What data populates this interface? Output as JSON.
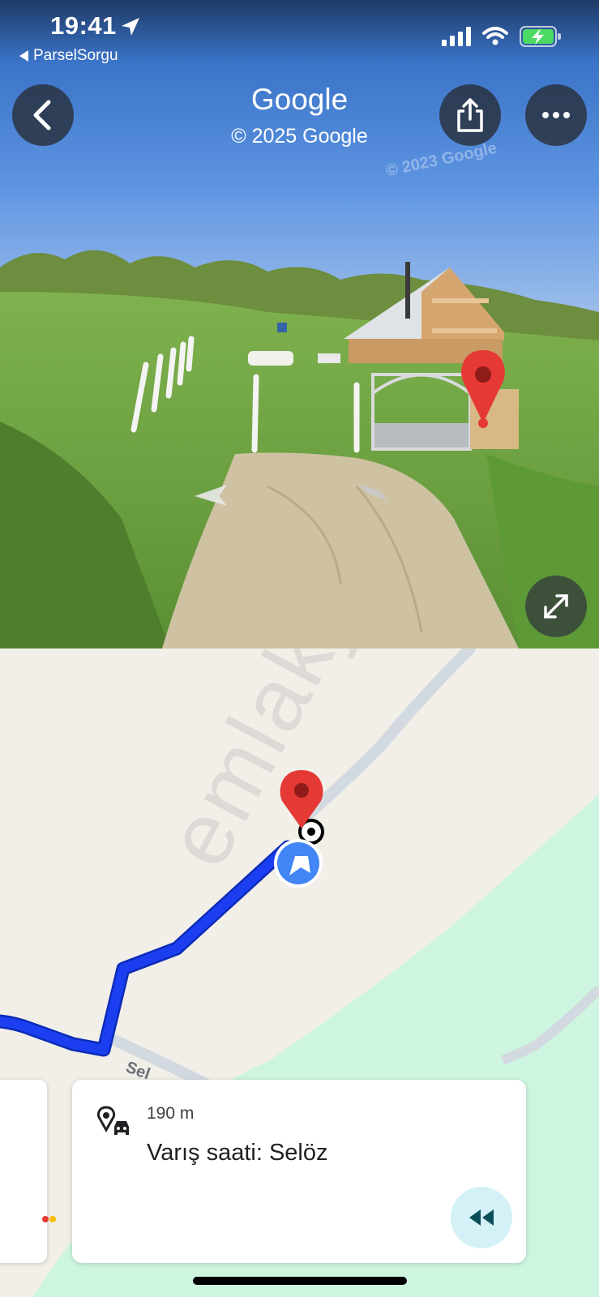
{
  "status_bar": {
    "time": "19:41",
    "back_app": "ParselSorgu",
    "battery_color": "#4cd964"
  },
  "street_view": {
    "title": "Google",
    "copyright": "© 2025 Google",
    "image_watermark": "© 2023 Google",
    "icons": {
      "back": "chevron-left-icon",
      "share": "share-icon",
      "more": "more-horizontal-icon",
      "expand": "expand-icon",
      "pin": "location-pin-icon"
    }
  },
  "map": {
    "watermark": "emlakj",
    "road_label": "Sel",
    "colors": {
      "route": "#1b3ff0",
      "park": "#cdf5e0",
      "pin": "#e53935",
      "nav": "#4285f4"
    }
  },
  "card": {
    "distance": "190 m",
    "title": "Varış saati: Selöz",
    "icons": {
      "pin_car": "pin-car-icon",
      "rewind": "rewind-icon"
    }
  }
}
